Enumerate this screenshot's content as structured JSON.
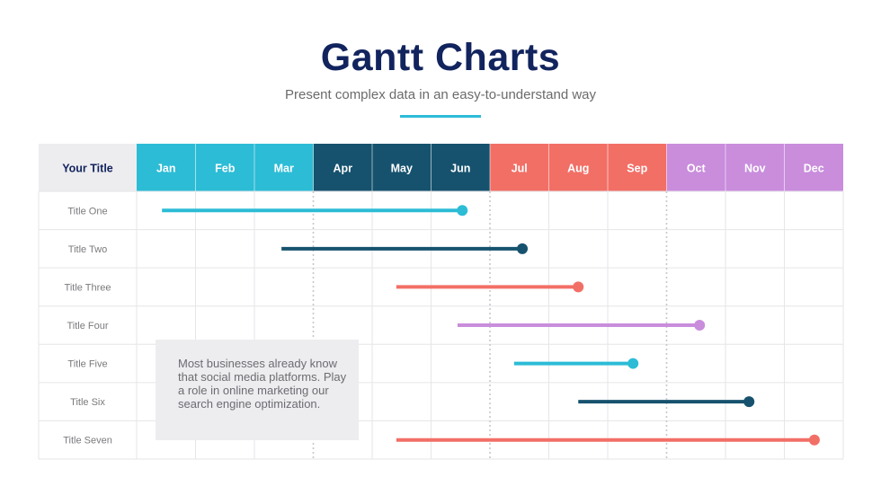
{
  "header": {
    "title": "Gantt Charts",
    "subtitle": "Present complex data in an easy-to-understand way"
  },
  "chart_data": {
    "type": "gantt",
    "corner_label": "Your Title",
    "categories": [
      "Jan",
      "Feb",
      "Mar",
      "Apr",
      "May",
      "Jun",
      "Jul",
      "Aug",
      "Sep",
      "Oct",
      "Nov",
      "Dec"
    ],
    "header_colors": [
      "#2cbcd6",
      "#2cbcd6",
      "#2cbcd6",
      "#16526e",
      "#16526e",
      "#16526e",
      "#f26f66",
      "#f26f66",
      "#f26f66",
      "#c98ddc",
      "#c98ddc",
      "#c98ddc"
    ],
    "quarter_dividers_after_month": [
      3,
      6,
      9
    ],
    "x_unit": "months from start of Jan",
    "xlim": [
      0,
      12
    ],
    "tasks": [
      {
        "label": "Title One",
        "start": 0.43,
        "end": 5.53,
        "color": "#2cbcd6"
      },
      {
        "label": "Title Two",
        "start": 2.46,
        "end": 6.55,
        "color": "#16526e"
      },
      {
        "label": "Title Three",
        "start": 4.41,
        "end": 7.5,
        "color": "#f26f66"
      },
      {
        "label": "Title Four",
        "start": 5.45,
        "end": 9.56,
        "color": "#c98ddc"
      },
      {
        "label": "Title Five",
        "start": 6.41,
        "end": 8.43,
        "color": "#2cbcd6"
      },
      {
        "label": "Title Six",
        "start": 7.5,
        "end": 10.4,
        "color": "#16526e"
      },
      {
        "label": "Title Seven",
        "start": 4.41,
        "end": 11.51,
        "color": "#f26f66"
      }
    ]
  },
  "note": {
    "text": "Most businesses already know that social media platforms. Play a role in online marketing our search engine optimization."
  },
  "colors": {
    "title": "#12245e",
    "corner_bg": "#ededef",
    "grid": "#e6e6e8"
  }
}
